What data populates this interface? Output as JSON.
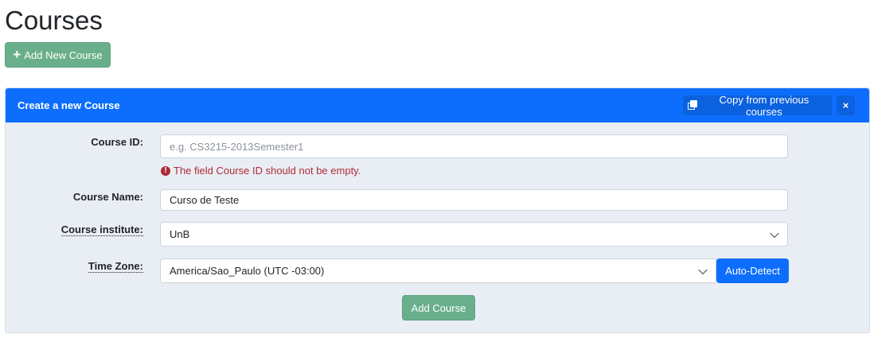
{
  "page": {
    "title": "Courses",
    "add_new_label": "Add New Course"
  },
  "panel": {
    "title": "Create a new Course",
    "copy_label": "Copy from previous courses",
    "close_label": "×"
  },
  "form": {
    "course_id": {
      "label": "Course ID:",
      "value": "",
      "placeholder": "e.g. CS3215-2013Semester1",
      "error": "The field Course ID should not be empty."
    },
    "course_name": {
      "label": "Course Name:",
      "value": "Curso de Teste"
    },
    "course_institute": {
      "label": "Course institute:",
      "selected": "UnB"
    },
    "time_zone": {
      "label": "Time Zone:",
      "selected": "America/Sao_Paulo (UTC -03:00)",
      "auto_detect_label": "Auto-Detect"
    },
    "submit_label": "Add Course"
  },
  "icons": {
    "add": "plus-icon",
    "copy": "copy-icon",
    "close": "close-icon",
    "error": "error-icon",
    "dropdown": "chevron-down-icon"
  },
  "colors": {
    "primary": "#0d6efd",
    "success": "#6aaf8b",
    "danger": "#b02a37",
    "panel_bg": "#e9eef4"
  }
}
